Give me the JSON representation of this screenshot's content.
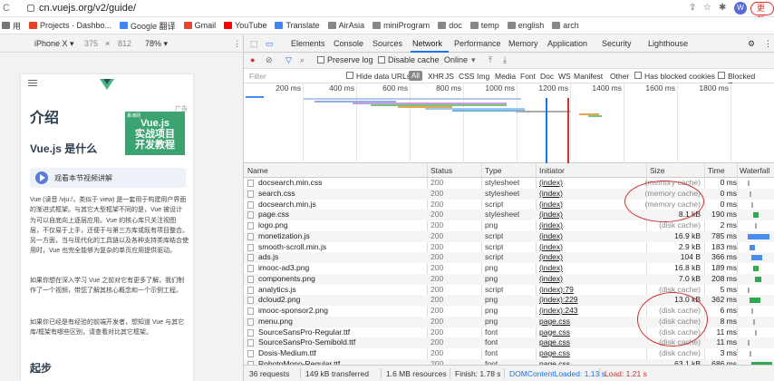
{
  "browser": {
    "url": "cn.vuejs.org/v2/guide/",
    "update_label": "更新",
    "avatar_letter": "W"
  },
  "bookmarks": [
    {
      "label": "用",
      "color": "#777777"
    },
    {
      "label": "Projects · Dashbo...",
      "color": "#e24329"
    },
    {
      "label": "Google 翻译",
      "color": "#4285f4"
    },
    {
      "label": "Gmail",
      "color": "#ea4335"
    },
    {
      "label": "YouTube",
      "color": "#ff0000"
    },
    {
      "label": "Translate",
      "color": "#4285f4"
    },
    {
      "label": "AirAsia",
      "color": "#888888"
    },
    {
      "label": "miniProgram",
      "color": "#888888"
    },
    {
      "label": "doc",
      "color": "#888888"
    },
    {
      "label": "temp",
      "color": "#888888"
    },
    {
      "label": "english",
      "color": "#888888"
    },
    {
      "label": "arch",
      "color": "#888888"
    }
  ],
  "device_toolbar": {
    "device": "iPhone X ▾",
    "width": "375",
    "times": "×",
    "height": "812",
    "zoom": "78% ▾"
  },
  "mobile_page": {
    "title": "介绍",
    "ad_label": "广告",
    "ad_brand": "慕课网",
    "ad_line1": "Vue.js",
    "ad_line2": "实战项目",
    "ad_line3": "开发教程",
    "section": "Vue.js 是什么",
    "video": "观看本节视频讲解",
    "para1": "Vue (读音 /vjuː/，类似于 view) 是一套用于构建用户界面的渐进式框架。与其它大型框架不同的是，Vue 被设计为可以自底向上逐层应用。Vue 的核心库只关注视图层，不仅易于上手，还便于与第三方库或既有项目整合。另一方面，当与现代化的工具链以及各种支持类库结合使用时，Vue 也完全能够为复杂的单页应用提供驱动。",
    "para2": "如果你想在深入学习 Vue 之前对它有更多了解，我们制作了一个视频，带您了解其核心概念和一个示例工程。",
    "para3": "如果你已经是有经验的前端开发者，想知道 Vue 与其它库/框架有哪些区别，请查看对比其它框架。",
    "heading2": "起步"
  },
  "devtools": {
    "tabs": [
      "Elements",
      "Console",
      "Sources",
      "Network",
      "Performance",
      "Memory",
      "Application",
      "Security",
      "Lighthouse"
    ],
    "active_tab": "Network",
    "preserve_log": "Preserve log",
    "disable_cache": "Disable cache",
    "throttle": "Online",
    "filter_placeholder": "Filter",
    "hide_data_urls": "Hide data URLs",
    "filter_types": [
      "All",
      "XHR",
      "JS",
      "CSS",
      "Img",
      "Media",
      "Font",
      "Doc",
      "WS",
      "Manifest",
      "Other"
    ],
    "has_blocked_cookies": "Has blocked cookies",
    "blocked_requests": "Blocked Reque",
    "timeline_ticks": [
      "200 ms",
      "400 ms",
      "600 ms",
      "800 ms",
      "1000 ms",
      "1200 ms",
      "1400 ms",
      "1600 ms",
      "1800 ms"
    ],
    "columns": [
      "Name",
      "Status",
      "Type",
      "Initiator",
      "Size",
      "Time",
      "Waterfall"
    ],
    "rows": [
      {
        "name": "docsearch.min.css",
        "status": "200",
        "type": "stylesheet",
        "initiator": "(index)",
        "size": "(memory cache)",
        "time": "0 ms"
      },
      {
        "name": "search.css",
        "status": "200",
        "type": "stylesheet",
        "initiator": "(index)",
        "size": "(memory cache)",
        "time": "0 ms"
      },
      {
        "name": "docsearch.min.js",
        "status": "200",
        "type": "script",
        "initiator": "(index)",
        "size": "(memory cache)",
        "time": "0 ms"
      },
      {
        "name": "page.css",
        "status": "200",
        "type": "stylesheet",
        "initiator": "(index)",
        "size": "8.1 kB",
        "time": "190 ms"
      },
      {
        "name": "logo.png",
        "status": "200",
        "type": "png",
        "initiator": "(index)",
        "size": "(disk cache)",
        "time": "2 ms"
      },
      {
        "name": "monetization.js",
        "status": "200",
        "type": "script",
        "initiator": "(index)",
        "size": "16.9 kB",
        "time": "785 ms"
      },
      {
        "name": "smooth-scroll.min.js",
        "status": "200",
        "type": "script",
        "initiator": "(index)",
        "size": "2.9 kB",
        "time": "183 ms"
      },
      {
        "name": "ads.js",
        "status": "200",
        "type": "script",
        "initiator": "(index)",
        "size": "104 B",
        "time": "366 ms"
      },
      {
        "name": "imooc-ad3.png",
        "status": "200",
        "type": "png",
        "initiator": "(index)",
        "size": "16.8 kB",
        "time": "189 ms"
      },
      {
        "name": "components.png",
        "status": "200",
        "type": "png",
        "initiator": "(index)",
        "size": "7.0 kB",
        "time": "208 ms"
      },
      {
        "name": "analytics.js",
        "status": "200",
        "type": "script",
        "initiator": "(index):79",
        "size": "(disk cache)",
        "time": "5 ms"
      },
      {
        "name": "dcloud2.png",
        "status": "200",
        "type": "png",
        "initiator": "(index):229",
        "size": "13.0 kB",
        "time": "362 ms"
      },
      {
        "name": "imooc-sponsor2.png",
        "status": "200",
        "type": "png",
        "initiator": "(index):243",
        "size": "(disk cache)",
        "time": "6 ms"
      },
      {
        "name": "menu.png",
        "status": "200",
        "type": "png",
        "initiator": "page.css",
        "size": "(disk cache)",
        "time": "8 ms"
      },
      {
        "name": "SourceSansPro-Regular.ttf",
        "status": "200",
        "type": "font",
        "initiator": "page.css",
        "size": "(disk cache)",
        "time": "11 ms"
      },
      {
        "name": "SourceSansPro-Semibold.ttf",
        "status": "200",
        "type": "font",
        "initiator": "page.css",
        "size": "(disk cache)",
        "time": "11 ms"
      },
      {
        "name": "Dosis-Medium.ttf",
        "status": "200",
        "type": "font",
        "initiator": "page.css",
        "size": "(disk cache)",
        "time": "3 ms"
      },
      {
        "name": "RobotoMono-Regular.ttf",
        "status": "200",
        "type": "font",
        "initiator": "page.css",
        "size": "63.1 kB",
        "time": "686 ms"
      }
    ],
    "status_bar": {
      "requests": "36 requests",
      "transferred": "149 kB transferred",
      "resources": "1.6 MB resources",
      "finish": "Finish: 1.78 s",
      "dcl": "DOMContentLoaded: 1.13 s",
      "load": "Load: 1.21 s"
    }
  },
  "colors": {
    "accent_blue": "#1a73e8",
    "vue_green": "#42b983",
    "annotation_red": "#d32f2f",
    "dcl_blue": "#1a73e8",
    "load_red": "#d32f2f"
  }
}
